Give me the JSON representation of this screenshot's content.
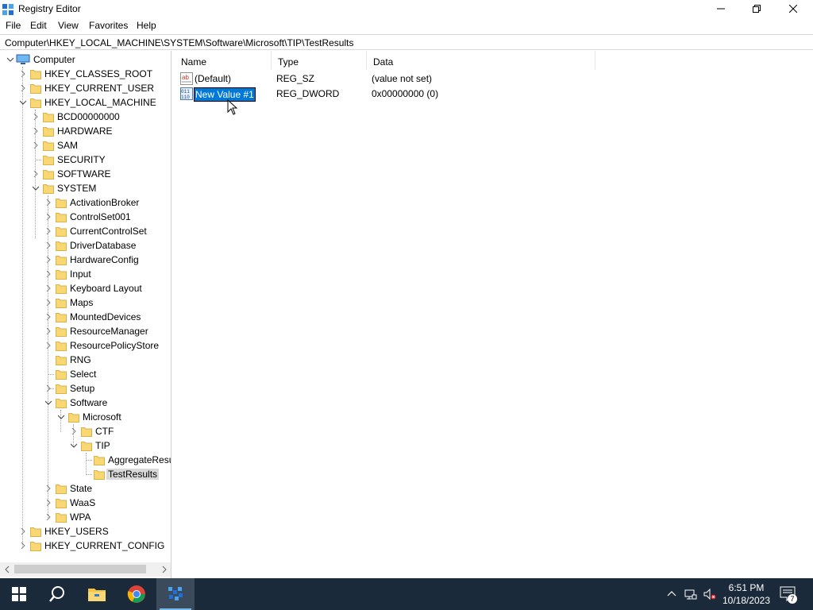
{
  "window": {
    "title": "Registry Editor"
  },
  "menu": [
    "File",
    "Edit",
    "View",
    "Favorites",
    "Help"
  ],
  "address": "Computer\\HKEY_LOCAL_MACHINE\\SYSTEM\\Software\\Microsoft\\TIP\\TestResults",
  "tree": {
    "root": "Computer",
    "items": [
      {
        "label": "HKEY_CLASSES_ROOT"
      },
      {
        "label": "HKEY_CURRENT_USER"
      },
      {
        "label": "HKEY_LOCAL_MACHINE"
      },
      {
        "label": "BCD00000000"
      },
      {
        "label": "HARDWARE"
      },
      {
        "label": "SAM"
      },
      {
        "label": "SECURITY"
      },
      {
        "label": "SOFTWARE"
      },
      {
        "label": "SYSTEM"
      },
      {
        "label": "ActivationBroker"
      },
      {
        "label": "ControlSet001"
      },
      {
        "label": "CurrentControlSet"
      },
      {
        "label": "DriverDatabase"
      },
      {
        "label": "HardwareConfig"
      },
      {
        "label": "Input"
      },
      {
        "label": "Keyboard Layout"
      },
      {
        "label": "Maps"
      },
      {
        "label": "MountedDevices"
      },
      {
        "label": "ResourceManager"
      },
      {
        "label": "ResourcePolicyStore"
      },
      {
        "label": "RNG"
      },
      {
        "label": "Select"
      },
      {
        "label": "Setup"
      },
      {
        "label": "Software"
      },
      {
        "label": "Microsoft"
      },
      {
        "label": "CTF"
      },
      {
        "label": "TIP"
      },
      {
        "label": "AggregateResults"
      },
      {
        "label": "TestResults"
      },
      {
        "label": "State"
      },
      {
        "label": "WaaS"
      },
      {
        "label": "WPA"
      },
      {
        "label": "HKEY_USERS"
      },
      {
        "label": "HKEY_CURRENT_CONFIG"
      }
    ]
  },
  "columns": {
    "name": "Name",
    "type": "Type",
    "data": "Data"
  },
  "values": [
    {
      "name": "(Default)",
      "type": "REG_SZ",
      "data": "(value not set)",
      "icon": "string-value-icon"
    },
    {
      "name": "New Value #1",
      "type": "REG_DWORD",
      "data": "0x00000000 (0)",
      "icon": "binary-value-icon"
    }
  ],
  "taskbar": {
    "time": "6:51 PM",
    "date": "10/18/2023",
    "notification_count": "7"
  },
  "colors": {
    "selection": "#0078d7",
    "folder": "#f8d775",
    "taskbar": "#1b2a3a"
  }
}
